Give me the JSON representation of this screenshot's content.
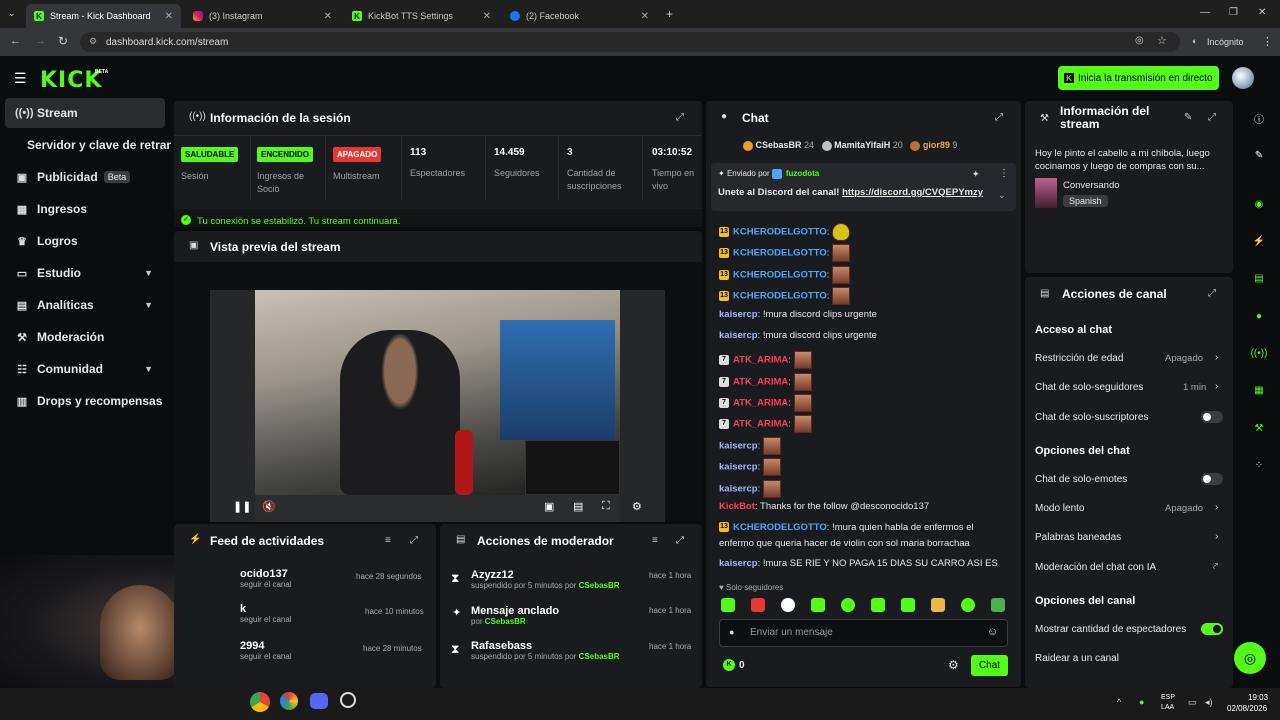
{
  "browser": {
    "tabs": [
      {
        "label": "Stream - Kick Dashboard",
        "active": true
      },
      {
        "label": "(3) Instagram"
      },
      {
        "label": "KickBot TTS Settings"
      },
      {
        "label": "(2) Facebook"
      }
    ],
    "url": "dashboard.kick.com/stream",
    "profile": "Incógnito"
  },
  "header": {
    "logo": "KICK",
    "beta": "BETA",
    "go_live": "Inicia la transmisión en directo"
  },
  "sidebar": {
    "items": [
      {
        "label": "Stream"
      },
      {
        "label": "Servidor y clave de retransn"
      },
      {
        "label": "Publicidad",
        "badge": "Beta"
      },
      {
        "label": "Ingresos"
      },
      {
        "label": "Logros"
      },
      {
        "label": "Estudio"
      },
      {
        "label": "Analíticas"
      },
      {
        "label": "Moderación"
      },
      {
        "label": "Comunidad"
      },
      {
        "label": "Drops y recompensas"
      }
    ]
  },
  "session": {
    "title": "Información de la sesión",
    "badges": [
      {
        "value": "SALUDABLE",
        "label": "Sesión"
      },
      {
        "value": "ENCENDIDO",
        "label": "Ingresos de Socio"
      },
      {
        "value": "APAGADO",
        "label": "Multistream"
      }
    ],
    "stats": [
      {
        "value": "113",
        "label": "Espectadores"
      },
      {
        "value": "14.459",
        "label": "Seguidores"
      },
      {
        "value": "3",
        "label": "Cantidad de suscripciones"
      },
      {
        "value": "03:10:52",
        "label": "Tiempo en vivo"
      }
    ],
    "connection": "Tu conexión se estabilizó. Tu stream continuará."
  },
  "preview": {
    "title": "Vista previa del stream"
  },
  "feed": {
    "title": "Feed de actividades",
    "items": [
      {
        "name": "ocido137",
        "sub": "seguir el canal",
        "time": "hace 28 segundos"
      },
      {
        "name": "k",
        "sub": "seguir el canal",
        "time": "hace 10 minutos"
      },
      {
        "name": "2994",
        "sub": "seguir el canal",
        "time": "hace 28 minutos"
      }
    ]
  },
  "modactions": {
    "title": "Acciones de moderador",
    "items": [
      {
        "name": "Azyzz12",
        "sub": "suspendido por 5 minutos por",
        "by": "CSebasBR",
        "time": "hace 1 hora"
      },
      {
        "name": "Mensaje anclado",
        "sub": "por",
        "by": "CSebasBR",
        "time": "hace 1 hora"
      },
      {
        "name": "Rafasebass",
        "sub": "suspendido por 5 minutos por",
        "by": "CSebasBR",
        "time": "hace 1 hora"
      }
    ]
  },
  "chat": {
    "title": "Chat",
    "top": [
      {
        "name": "CSebasBR",
        "count": "24"
      },
      {
        "name": "MamitaYifaiH",
        "count": "20"
      },
      {
        "name": "gior89",
        "count": "9"
      }
    ],
    "pinned": {
      "label": "Enviado por",
      "by": "fuzodota",
      "text": "Unete al Discord del canal!",
      "link": "https://discord.gg/CVQEPYmzy"
    },
    "messages": [
      {
        "badge": "13",
        "user": "KCHERODELGOTTO",
        "color": "#4aa8ff",
        "text": ""
      },
      {
        "badge": "13",
        "user": "KCHERODELGOTTO",
        "color": "#4aa8ff",
        "text": ""
      },
      {
        "badge": "13",
        "user": "KCHERODELGOTTO",
        "color": "#4aa8ff",
        "text": ""
      },
      {
        "badge": "13",
        "user": "KCHERODELGOTTO",
        "color": "#4aa8ff",
        "text": ""
      },
      {
        "badge": "",
        "user": "kaisercp",
        "color": "#9fb8ff",
        "text": "!mura discord clips urgente"
      },
      {
        "badge": "",
        "user": "kaisercp",
        "color": "#9fb8ff",
        "text": "!mura discord clips urgente"
      },
      {
        "badge": "7",
        "user": "ATK_ARIMA",
        "color": "#ff3b5c",
        "text": ""
      },
      {
        "badge": "7",
        "user": "ATK_ARIMA",
        "color": "#ff3b5c",
        "text": ""
      },
      {
        "badge": "7",
        "user": "ATK_ARIMA",
        "color": "#ff3b5c",
        "text": ""
      },
      {
        "badge": "7",
        "user": "ATK_ARIMA",
        "color": "#ff3b5c",
        "text": ""
      },
      {
        "badge": "",
        "user": "kaisercp",
        "color": "#9fb8ff",
        "text": ""
      },
      {
        "badge": "",
        "user": "kaisercp",
        "color": "#9fb8ff",
        "text": ""
      },
      {
        "badge": "",
        "user": "kaisercp",
        "color": "#9fb8ff",
        "text": ""
      },
      {
        "badge": "",
        "user": "KickBot",
        "color": "#ff3b5c",
        "text": "Thanks for the follow @desconocido137"
      },
      {
        "badge": "13",
        "user": "KCHERODELGOTTO",
        "color": "#4aa8ff",
        "text": "!mura quien habla de enfermos el"
      },
      {
        "badge": "",
        "user": "",
        "color": "#e8e8e8",
        "text": "enfermo que queria hacer de violin con sol maria borrachaa"
      },
      {
        "badge": "",
        "user": "kaisercp",
        "color": "#9fb8ff",
        "text": "!mura SE RIE Y NO PAGA 15 DIAS SU CARRO ASI ES"
      }
    ],
    "followers_only": "Solo seguidores",
    "input_placeholder": "Enviar un mensaje",
    "points": "0",
    "send": "Chat"
  },
  "streaminfo": {
    "title": "Información del stream",
    "desc": "Hoy le pinto el cabello a mi chibola, luego cocinamos y luego de compras con su...",
    "category": "Conversando",
    "language": "Spanish"
  },
  "channel_actions": {
    "title": "Acciones de canal",
    "s1": "Acceso al chat",
    "rows1": [
      {
        "label": "Restricción de edad",
        "value": "Apagado"
      },
      {
        "label": "Chat de solo-seguidores",
        "value": "1 min"
      },
      {
        "label": "Chat de solo-suscriptores",
        "value": ""
      }
    ],
    "s2": "Opciones del chat",
    "rows2": [
      {
        "label": "Chat de solo-emotes",
        "value": ""
      },
      {
        "label": "Modo lento",
        "value": "Apagado"
      },
      {
        "label": "Palabras baneadas",
        "value": ""
      },
      {
        "label": "Moderación del chat con IA",
        "value": ""
      }
    ],
    "s3": "Opciones del canal",
    "rows3": [
      {
        "label": "Mostrar cantidad de espectadores",
        "value": ""
      },
      {
        "label": "Raidear a un canal",
        "value": ""
      }
    ]
  },
  "taskbar": {
    "lang": "ESP",
    "lang2": "LAA",
    "time": "19:03",
    "date": "02/08/2026"
  }
}
